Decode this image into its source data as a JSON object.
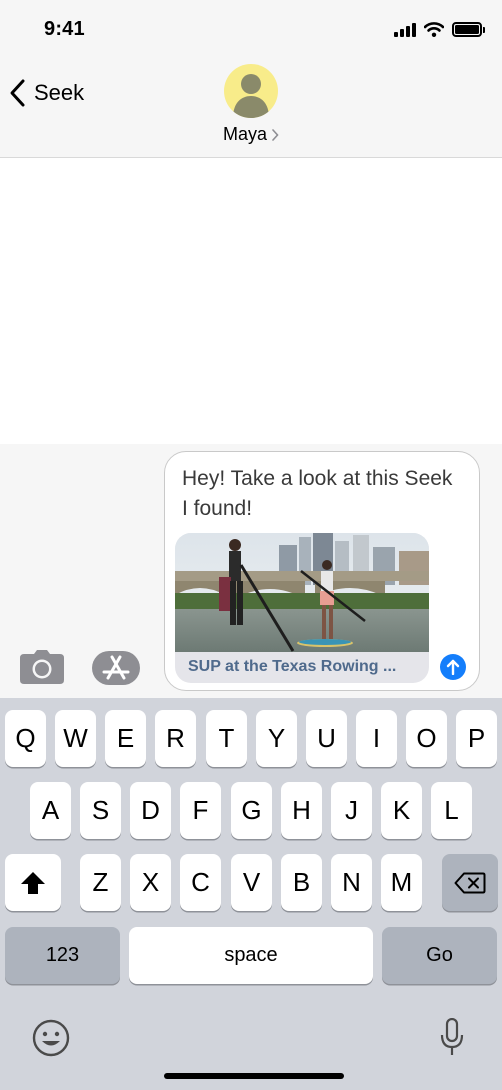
{
  "status_bar": {
    "time": "9:41"
  },
  "header": {
    "back_label": "Seek",
    "contact_name": "Maya"
  },
  "message": {
    "text": "Hey! Take a look at this Seek I found!",
    "link_title": "SUP at the Texas Rowing ..."
  },
  "keyboard": {
    "row1": [
      "Q",
      "W",
      "E",
      "R",
      "T",
      "Y",
      "U",
      "I",
      "O",
      "P"
    ],
    "row2": [
      "A",
      "S",
      "D",
      "F",
      "G",
      "H",
      "J",
      "K",
      "L"
    ],
    "row3": [
      "Z",
      "X",
      "C",
      "V",
      "B",
      "N",
      "M"
    ],
    "numbers_label": "123",
    "space_label": "space",
    "go_label": "Go"
  },
  "colors": {
    "accent": "#147efb",
    "link_title": "#4f6a8c",
    "avatar_bg": "#f8ec8a",
    "keyboard_bg": "#d1d4db"
  },
  "icons": [
    "chevron-left-icon",
    "chevron-right-icon",
    "signal-icon",
    "wifi-icon",
    "battery-icon",
    "camera-icon",
    "app-store-icon",
    "send-arrow-icon",
    "shift-icon",
    "delete-icon",
    "emoji-icon",
    "microphone-icon"
  ]
}
